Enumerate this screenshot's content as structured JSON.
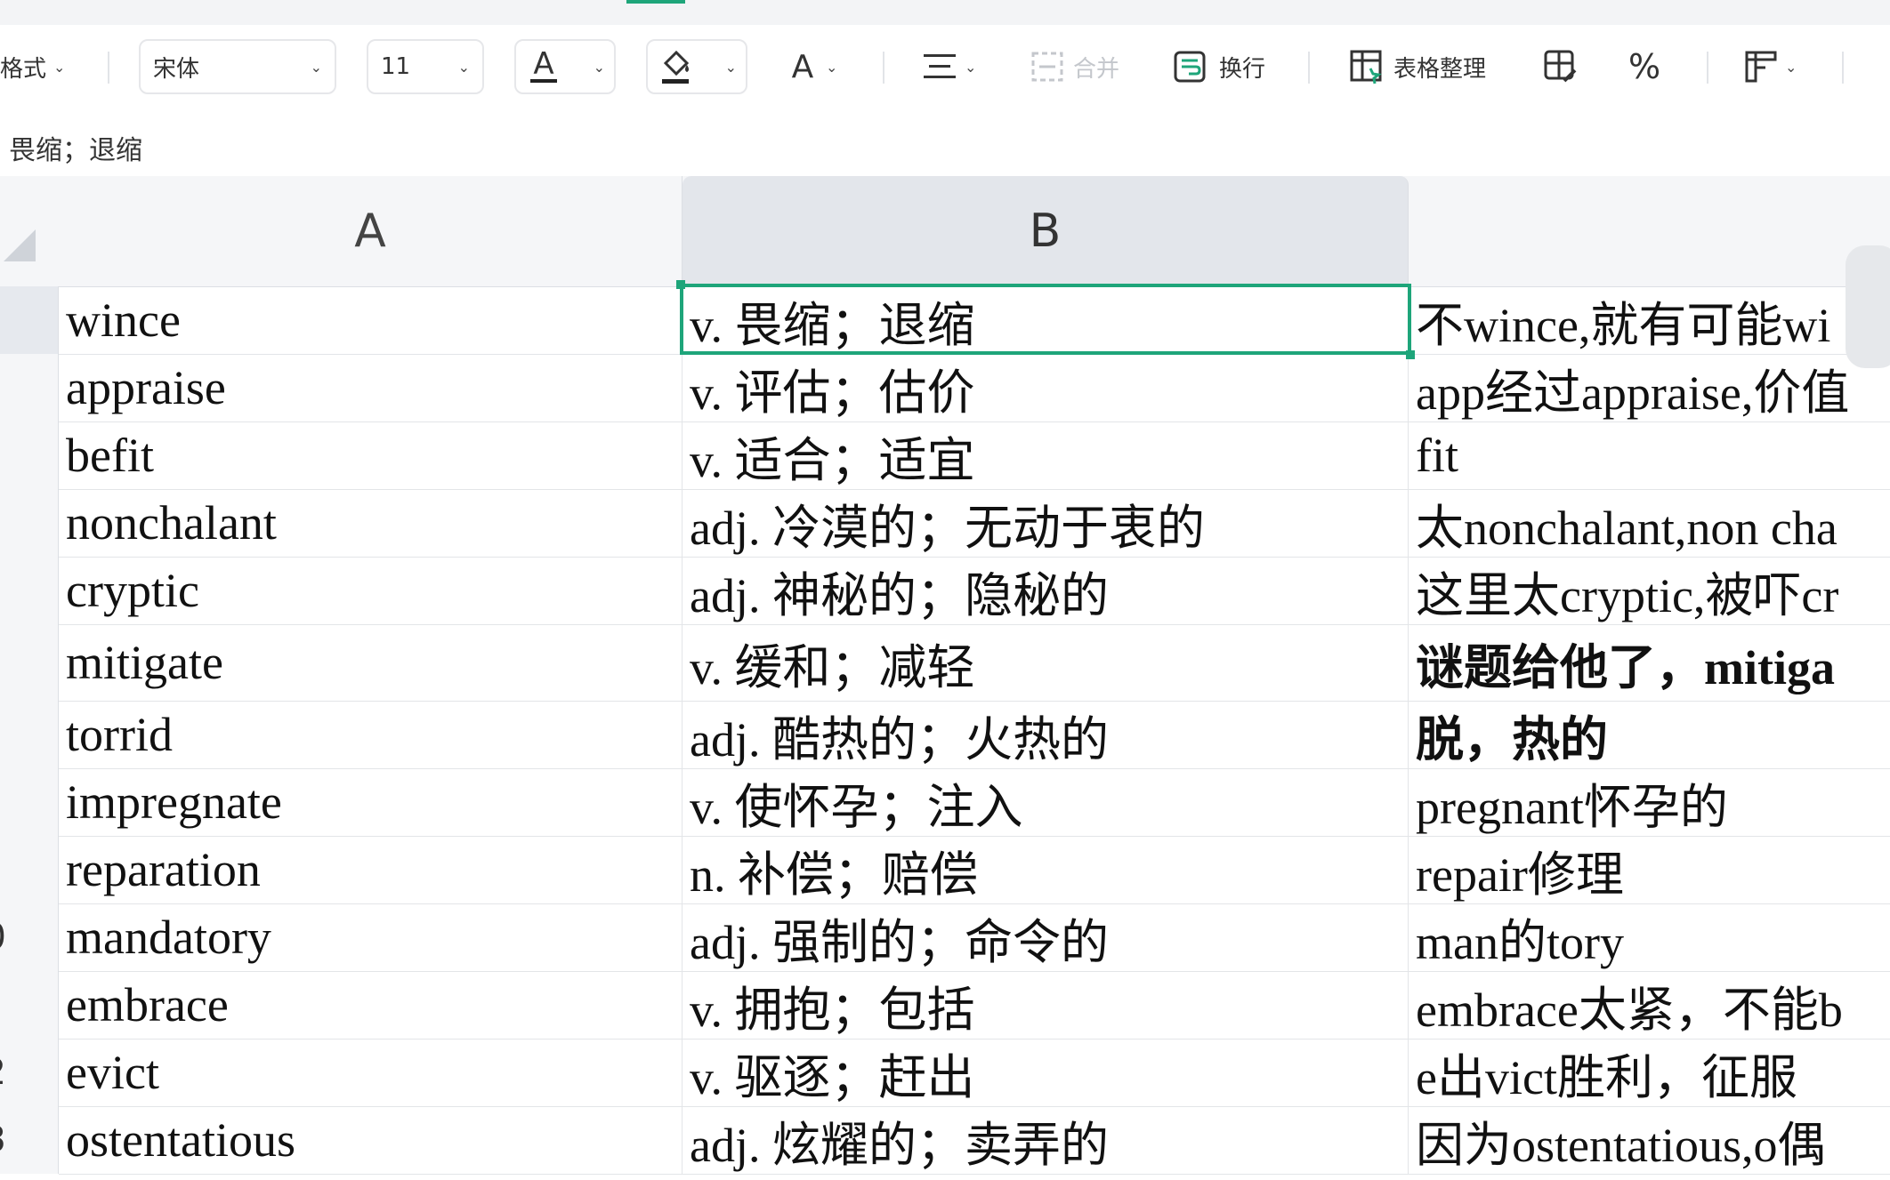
{
  "toolbar": {
    "format_label": "格式",
    "font_name": "宋体",
    "font_size": "11",
    "merge_label": "合并",
    "wrap_label": "换行",
    "table_tidy_label": "表格整理",
    "percent_symbol": "%"
  },
  "formula_bar": {
    "content": "畏缩；退缩"
  },
  "columns": [
    "A",
    "B"
  ],
  "rows": [
    {
      "num": "",
      "word": "wince",
      "meaning": "v. 畏缩；退缩",
      "note": "不wince,就有可能wi"
    },
    {
      "num": "",
      "word": "appraise",
      "meaning": "v. 评估；估价",
      "note": "app经过appraise,价值"
    },
    {
      "num": "",
      "word": "befit",
      "meaning": "v. 适合；适宜",
      "note": "fit"
    },
    {
      "num": "",
      "word": "nonchalant",
      "meaning": "adj. 冷漠的；无动于衷的",
      "note": "太nonchalant,non cha"
    },
    {
      "num": "",
      "word": "cryptic",
      "meaning": "adj. 神秘的；隐秘的",
      "note": "这里太cryptic,被吓cr"
    },
    {
      "num": "",
      "word": "mitigate",
      "meaning": "v. 缓和；减轻",
      "note": "谜题给他了，mitiga"
    },
    {
      "num": "",
      "word": "torrid",
      "meaning": "adj. 酷热的；火热的",
      "note": "脱，热的"
    },
    {
      "num": "",
      "word": "impregnate",
      "meaning": "v. 使怀孕；注入",
      "note": "pregnant怀孕的"
    },
    {
      "num": "",
      "word": "reparation",
      "meaning": "n. 补偿；赔偿",
      "note": "repair修理"
    },
    {
      "num": "0",
      "word": "mandatory",
      "meaning": "adj. 强制的；命令的",
      "note": "man的tory"
    },
    {
      "num": "",
      "word": "embrace",
      "meaning": "v. 拥抱；包括",
      "note": "embrace太紧，不能b"
    },
    {
      "num": "2",
      "word": "evict",
      "meaning": "v. 驱逐；赶出",
      "note": "e出vict胜利，征服"
    },
    {
      "num": "3",
      "word": "ostentatious",
      "meaning": "adj. 炫耀的；卖弄的",
      "note": "因为ostentatious,o偶"
    }
  ],
  "colors": {
    "accent": "#1ea57a",
    "header_bg": "#f5f6f8",
    "selected_header_bg": "#e3e6eb"
  }
}
